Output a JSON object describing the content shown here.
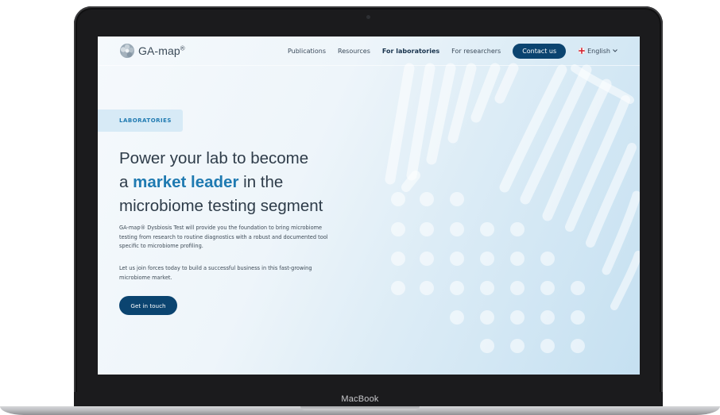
{
  "device": {
    "label": "MacBook"
  },
  "nav": {
    "logo_text": "GA-map",
    "logo_reg": "®",
    "links": [
      "Publications",
      "Resources",
      "For laboratories",
      "For researchers"
    ],
    "active_link": "For laboratories",
    "contact_label": "Contact us",
    "language": "English"
  },
  "hero": {
    "tag": "LABORATORIES",
    "headline_line1": "Power your lab to become",
    "headline_pre": "a ",
    "headline_highlight": "market leader",
    "headline_post": " in the",
    "headline_line3": "microbiome testing segment",
    "paragraph1": "GA-map® Dysbiosis Test will provide you the foundation to bring microbiome testing from research to routine diagnostics with a robust and documented tool specific to microbiome profiling.",
    "paragraph2": "Let us join forces today to build a successful business in this fast-growing microbiome market.",
    "cta_label": "Get in touch"
  },
  "colors": {
    "accent": "#1f7ab1",
    "primary_button": "#0b4470",
    "heading": "#2e3c49",
    "tag_background": "#d7eaf6"
  }
}
